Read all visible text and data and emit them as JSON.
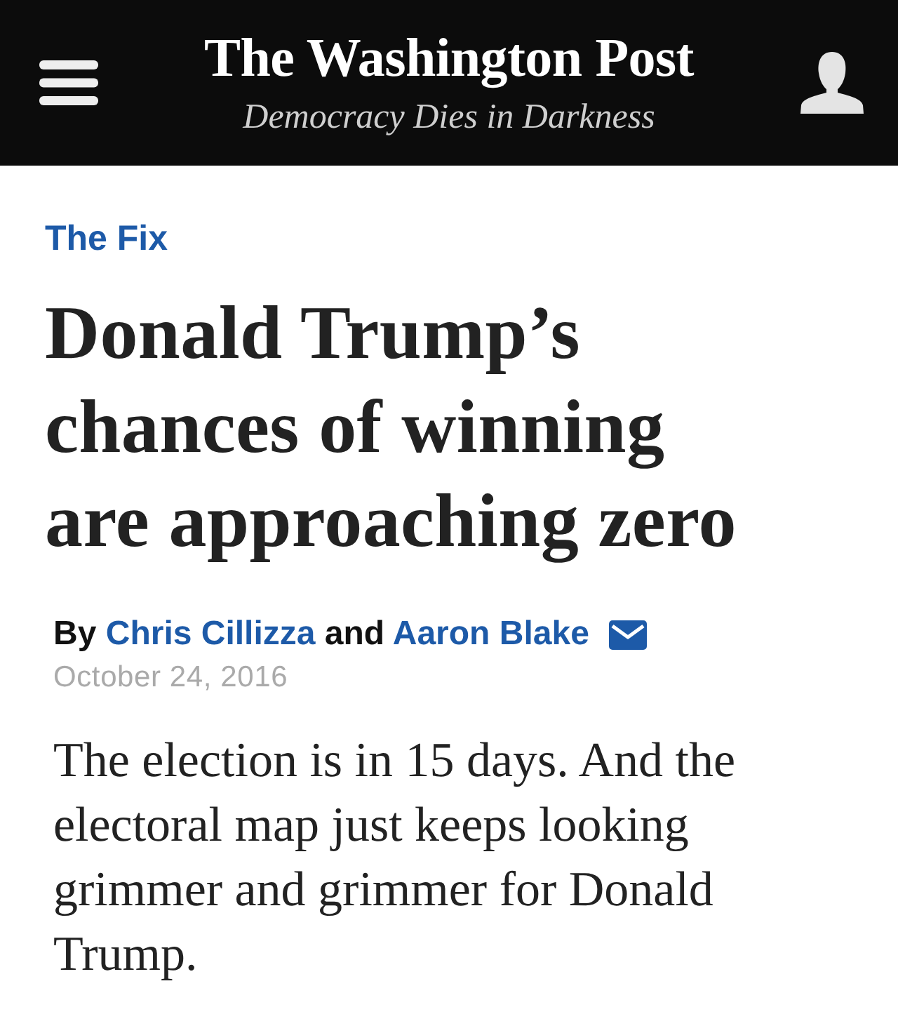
{
  "header": {
    "masthead": "The Washington Post",
    "tagline": "Democracy Dies in Darkness"
  },
  "article": {
    "section": "The Fix",
    "headline": "Donald Trump’s chances of winning are approaching zero",
    "byline": {
      "prefix": "By",
      "authors": [
        "Chris Cillizza",
        "Aaron Blake"
      ],
      "conjunction": "and"
    },
    "date": "October 24, 2016",
    "lede": "The election is in 15 days. And the electoral map just keeps looking grimmer and grimmer for Donald Trump."
  }
}
